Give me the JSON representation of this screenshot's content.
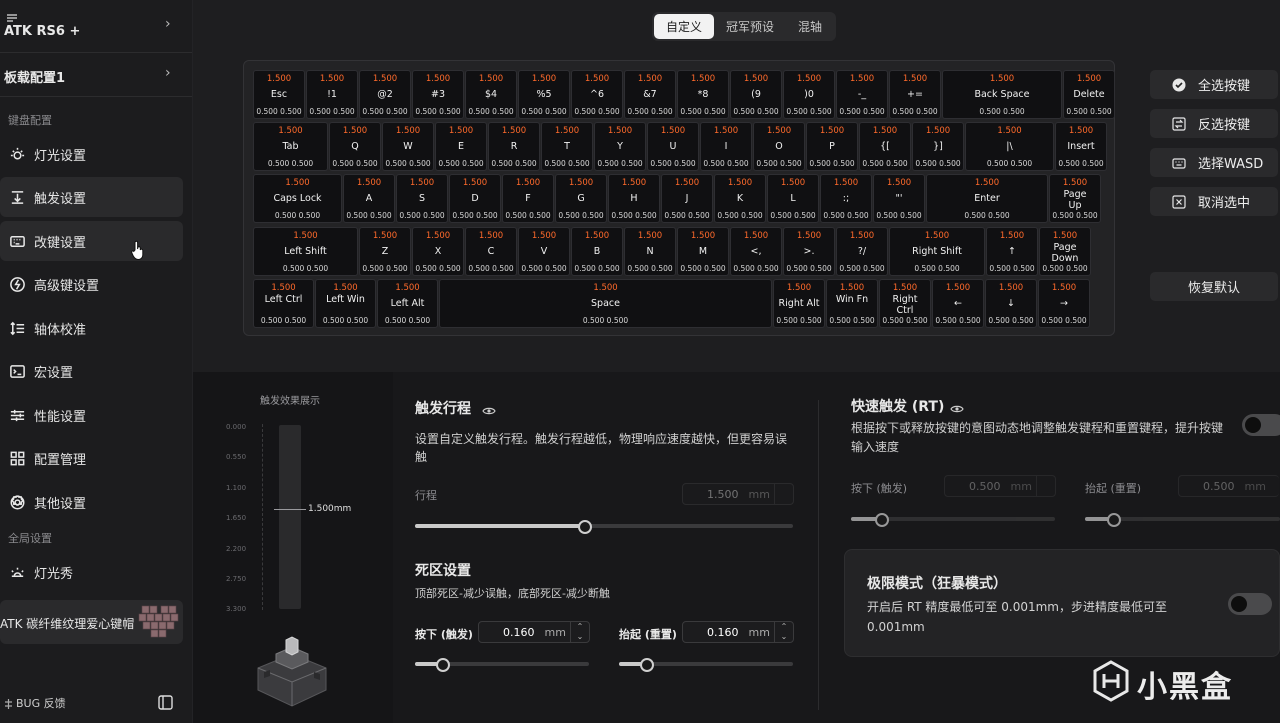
{
  "sidebar": {
    "device_name": "ATK RS6 +",
    "profile_name": "板载配置1",
    "section_keyboard": "键盘配置",
    "items": [
      {
        "label": "灯光设置",
        "icon": "sun-icon"
      },
      {
        "label": "触发设置",
        "icon": "trigger-icon"
      },
      {
        "label": "改键设置",
        "icon": "keyboard-icon"
      },
      {
        "label": "高级键设置",
        "icon": "bolt-icon"
      },
      {
        "label": "轴体校准",
        "icon": "calibration-icon"
      },
      {
        "label": "宏设置",
        "icon": "terminal-icon"
      },
      {
        "label": "性能设置",
        "icon": "sliders-icon"
      },
      {
        "label": "配置管理",
        "icon": "grid-icon"
      },
      {
        "label": "其他设置",
        "icon": "gear-icon"
      }
    ],
    "section_global": "全局设置",
    "global_items": [
      {
        "label": "灯光秀",
        "icon": "sunrise-icon"
      }
    ],
    "promo": "ATK 碳纤维纹理爱心键帽",
    "bug_feedback": "BUG 反馈"
  },
  "tabs": [
    {
      "label": "自定义",
      "active": true
    },
    {
      "label": "冠军预设",
      "active": false
    },
    {
      "label": "混轴",
      "active": false
    }
  ],
  "keyboard": {
    "accent": "#ff6a2b",
    "rows": [
      [
        {
          "v": "1.500",
          "n": "Esc",
          "t": "0.500 0.500"
        },
        {
          "v": "1.500",
          "n": "!1",
          "t": "0.500 0.500"
        },
        {
          "v": "1.500",
          "n": "@2",
          "t": "0.500 0.500"
        },
        {
          "v": "1.500",
          "n": "#3",
          "t": "0.500 0.500"
        },
        {
          "v": "1.500",
          "n": "$4",
          "t": "0.500 0.500"
        },
        {
          "v": "1.500",
          "n": "%5",
          "t": "0.500 0.500"
        },
        {
          "v": "1.500",
          "n": "^6",
          "t": "0.500 0.500"
        },
        {
          "v": "1.500",
          "n": "&7",
          "t": "0.500 0.500"
        },
        {
          "v": "1.500",
          "n": "*8",
          "t": "0.500 0.500"
        },
        {
          "v": "1.500",
          "n": "(9",
          "t": "0.500 0.500"
        },
        {
          "v": "1.500",
          "n": ")0",
          "t": "0.500 0.500"
        },
        {
          "v": "1.500",
          "n": "-_",
          "t": "0.500 0.500"
        },
        {
          "v": "1.500",
          "n": "+=",
          "t": "0.500 0.500"
        },
        {
          "v": "1.500",
          "n": "Back Space",
          "t": "0.500 0.500"
        },
        {
          "v": "1.500",
          "n": "Delete",
          "t": "0.500 0.500"
        }
      ],
      [
        {
          "v": "1.500",
          "n": "Tab",
          "t": "0.500 0.500"
        },
        {
          "v": "1.500",
          "n": "Q",
          "t": "0.500 0.500"
        },
        {
          "v": "1.500",
          "n": "W",
          "t": "0.500 0.500"
        },
        {
          "v": "1.500",
          "n": "E",
          "t": "0.500 0.500"
        },
        {
          "v": "1.500",
          "n": "R",
          "t": "0.500 0.500"
        },
        {
          "v": "1.500",
          "n": "T",
          "t": "0.500 0.500"
        },
        {
          "v": "1.500",
          "n": "Y",
          "t": "0.500 0.500"
        },
        {
          "v": "1.500",
          "n": "U",
          "t": "0.500 0.500"
        },
        {
          "v": "1.500",
          "n": "I",
          "t": "0.500 0.500"
        },
        {
          "v": "1.500",
          "n": "O",
          "t": "0.500 0.500"
        },
        {
          "v": "1.500",
          "n": "P",
          "t": "0.500 0.500"
        },
        {
          "v": "1.500",
          "n": "{[",
          "t": "0.500 0.500"
        },
        {
          "v": "1.500",
          "n": "}]",
          "t": "0.500 0.500"
        },
        {
          "v": "1.500",
          "n": "|\\",
          "t": "0.500 0.500"
        },
        {
          "v": "1.500",
          "n": "Insert",
          "t": "0.500 0.500"
        }
      ],
      [
        {
          "v": "1.500",
          "n": "Caps Lock",
          "t": "0.500 0.500"
        },
        {
          "v": "1.500",
          "n": "A",
          "t": "0.500 0.500"
        },
        {
          "v": "1.500",
          "n": "S",
          "t": "0.500 0.500"
        },
        {
          "v": "1.500",
          "n": "D",
          "t": "0.500 0.500"
        },
        {
          "v": "1.500",
          "n": "F",
          "t": "0.500 0.500"
        },
        {
          "v": "1.500",
          "n": "G",
          "t": "0.500 0.500"
        },
        {
          "v": "1.500",
          "n": "H",
          "t": "0.500 0.500"
        },
        {
          "v": "1.500",
          "n": "J",
          "t": "0.500 0.500"
        },
        {
          "v": "1.500",
          "n": "K",
          "t": "0.500 0.500"
        },
        {
          "v": "1.500",
          "n": "L",
          "t": "0.500 0.500"
        },
        {
          "v": "1.500",
          "n": ":;",
          "t": "0.500 0.500"
        },
        {
          "v": "1.500",
          "n": "\"'",
          "t": "0.500 0.500"
        },
        {
          "v": "1.500",
          "n": "Enter",
          "t": "0.500 0.500"
        },
        {
          "v": "1.500",
          "n": "Page Up",
          "t": "0.500 0.500"
        }
      ],
      [
        {
          "v": "1.500",
          "n": "Left Shift",
          "t": "0.500 0.500"
        },
        {
          "v": "1.500",
          "n": "Z",
          "t": "0.500 0.500"
        },
        {
          "v": "1.500",
          "n": "X",
          "t": "0.500 0.500"
        },
        {
          "v": "1.500",
          "n": "C",
          "t": "0.500 0.500"
        },
        {
          "v": "1.500",
          "n": "V",
          "t": "0.500 0.500"
        },
        {
          "v": "1.500",
          "n": "B",
          "t": "0.500 0.500"
        },
        {
          "v": "1.500",
          "n": "N",
          "t": "0.500 0.500"
        },
        {
          "v": "1.500",
          "n": "M",
          "t": "0.500 0.500"
        },
        {
          "v": "1.500",
          "n": "<,",
          "t": "0.500 0.500"
        },
        {
          "v": "1.500",
          "n": ">.",
          "t": "0.500 0.500"
        },
        {
          "v": "1.500",
          "n": "?/",
          "t": "0.500 0.500"
        },
        {
          "v": "1.500",
          "n": "Right Shift",
          "t": "0.500 0.500"
        },
        {
          "v": "1.500",
          "n": "↑",
          "t": "0.500 0.500"
        },
        {
          "v": "1.500",
          "n": "Page Down",
          "t": "0.500 0.500"
        }
      ],
      [
        {
          "v": "1.500",
          "n": "Left Ctrl",
          "t": "0.500 0.500"
        },
        {
          "v": "1.500",
          "n": "Left Win",
          "t": "0.500 0.500"
        },
        {
          "v": "1.500",
          "n": "Left Alt",
          "t": "0.500 0.500"
        },
        {
          "v": "1.500",
          "n": "Space",
          "t": "0.500 0.500"
        },
        {
          "v": "1.500",
          "n": "Right Alt",
          "t": "0.500 0.500"
        },
        {
          "v": "1.500",
          "n": "Win Fn",
          "t": "0.500 0.500"
        },
        {
          "v": "1.500",
          "n": "Right Ctrl",
          "t": "0.500 0.500"
        },
        {
          "v": "1.500",
          "n": "←",
          "t": "0.500 0.500"
        },
        {
          "v": "1.500",
          "n": "↓",
          "t": "0.500 0.500"
        },
        {
          "v": "1.500",
          "n": "→",
          "t": "0.500 0.500"
        }
      ]
    ]
  },
  "right_buttons": {
    "select_all": "全选按键",
    "invert": "反选按键",
    "select_wasd": "选择WASD",
    "deselect": "取消选中",
    "restore_default": "恢复默认"
  },
  "preview": {
    "title": "触发效果展示",
    "scale": [
      "0.000",
      "0.550",
      "1.100",
      "1.650",
      "2.200",
      "2.750",
      "3.300"
    ],
    "value_label": "1.500mm"
  },
  "trigger": {
    "title": "触发行程",
    "desc": "设置自定义触发行程。触发行程越低，物理响应速度越快，但更容易误触",
    "travel_label": "行程",
    "travel_value": "1.500",
    "unit": "mm",
    "travel_fraction": 0.45
  },
  "deadzone": {
    "title": "死区设置",
    "desc": "顶部死区-减少误触，底部死区-减少断触",
    "press_label": "按下 (触发)",
    "press_value": "0.160",
    "press_fraction": 0.16,
    "lift_label": "抬起 (重置)",
    "lift_value": "0.160",
    "lift_fraction": 0.16
  },
  "rapid": {
    "title": "快速触发 (RT)",
    "desc": "根据按下或释放按键的意图动态地调整触发键程和重置键程，提升按键输入速度",
    "press_label": "按下 (触发)",
    "press_value": "0.500",
    "press_fraction": 0.15,
    "lift_label": "抬起 (重置)",
    "lift_value": "0.500",
    "lift_fraction": 0.15,
    "enabled": false
  },
  "extreme": {
    "title": "极限模式（狂暴模式）",
    "desc": "开启后 RT 精度最低可至 0.001mm，步进精度最低可至 0.001mm",
    "enabled": false
  },
  "watermark": "小黑盒"
}
